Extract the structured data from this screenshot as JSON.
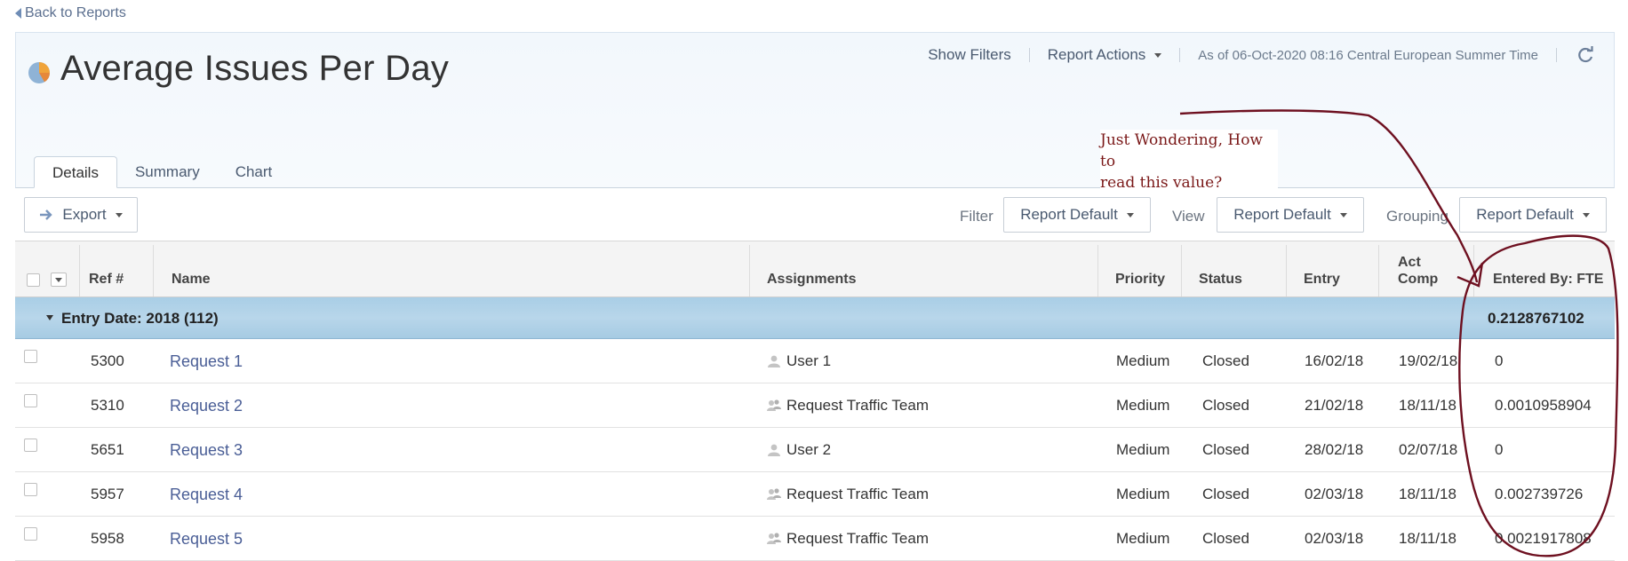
{
  "nav": {
    "back_label": "Back to Reports"
  },
  "header": {
    "title": "Average Issues Per Day",
    "show_filters": "Show Filters",
    "report_actions": "Report Actions",
    "as_of": "As of 06-Oct-2020 08:16 Central European Summer Time"
  },
  "tabs": [
    {
      "label": "Details",
      "active": true
    },
    {
      "label": "Summary",
      "active": false
    },
    {
      "label": "Chart",
      "active": false
    }
  ],
  "toolbar": {
    "export_label": "Export",
    "filter_label": "Filter",
    "filter_value": "Report Default",
    "view_label": "View",
    "view_value": "Report Default",
    "grouping_label": "Grouping",
    "grouping_value": "Report Default"
  },
  "table": {
    "columns": {
      "ref": "Ref #",
      "name": "Name",
      "assignments": "Assignments",
      "priority": "Priority",
      "status": "Status",
      "entry": "Entry",
      "act_comp_1": "Act",
      "act_comp_2": "Comp",
      "entered_by": "Entered By: FTE"
    },
    "group": {
      "label": "Entry Date: 2018 (112)",
      "value": "0.2128767102"
    },
    "rows": [
      {
        "ref": "5300",
        "name": "Request 1",
        "assignment": "User 1",
        "assignment_type": "user",
        "priority": "Medium",
        "status": "Closed",
        "entry": "16/02/18",
        "act_comp": "19/02/18",
        "fte": "0"
      },
      {
        "ref": "5310",
        "name": "Request 2",
        "assignment": "Request Traffic Team",
        "assignment_type": "team",
        "priority": "Medium",
        "status": "Closed",
        "entry": "21/02/18",
        "act_comp": "18/11/18",
        "fte": "0.0010958904"
      },
      {
        "ref": "5651",
        "name": "Request 3",
        "assignment": "User 2",
        "assignment_type": "user",
        "priority": "Medium",
        "status": "Closed",
        "entry": "28/02/18",
        "act_comp": "02/07/18",
        "fte": "0"
      },
      {
        "ref": "5957",
        "name": "Request 4",
        "assignment": "Request Traffic Team",
        "assignment_type": "team",
        "priority": "Medium",
        "status": "Closed",
        "entry": "02/03/18",
        "act_comp": "18/11/18",
        "fte": "0.002739726"
      },
      {
        "ref": "5958",
        "name": "Request 5",
        "assignment": "Request Traffic Team",
        "assignment_type": "team",
        "priority": "Medium",
        "status": "Closed",
        "entry": "02/03/18",
        "act_comp": "18/11/18",
        "fte": "0.0021917808"
      }
    ]
  },
  "annotation": {
    "text_line_1": "Just Wondering, How to",
    "text_line_2": "read this value?",
    "color": "#7a1818"
  },
  "icons": {
    "back": "arrow-left-icon",
    "report": "pie-chart-icon",
    "refresh": "refresh-icon",
    "export": "export-arrow-icon",
    "user": "person-icon",
    "team": "people-icon"
  }
}
